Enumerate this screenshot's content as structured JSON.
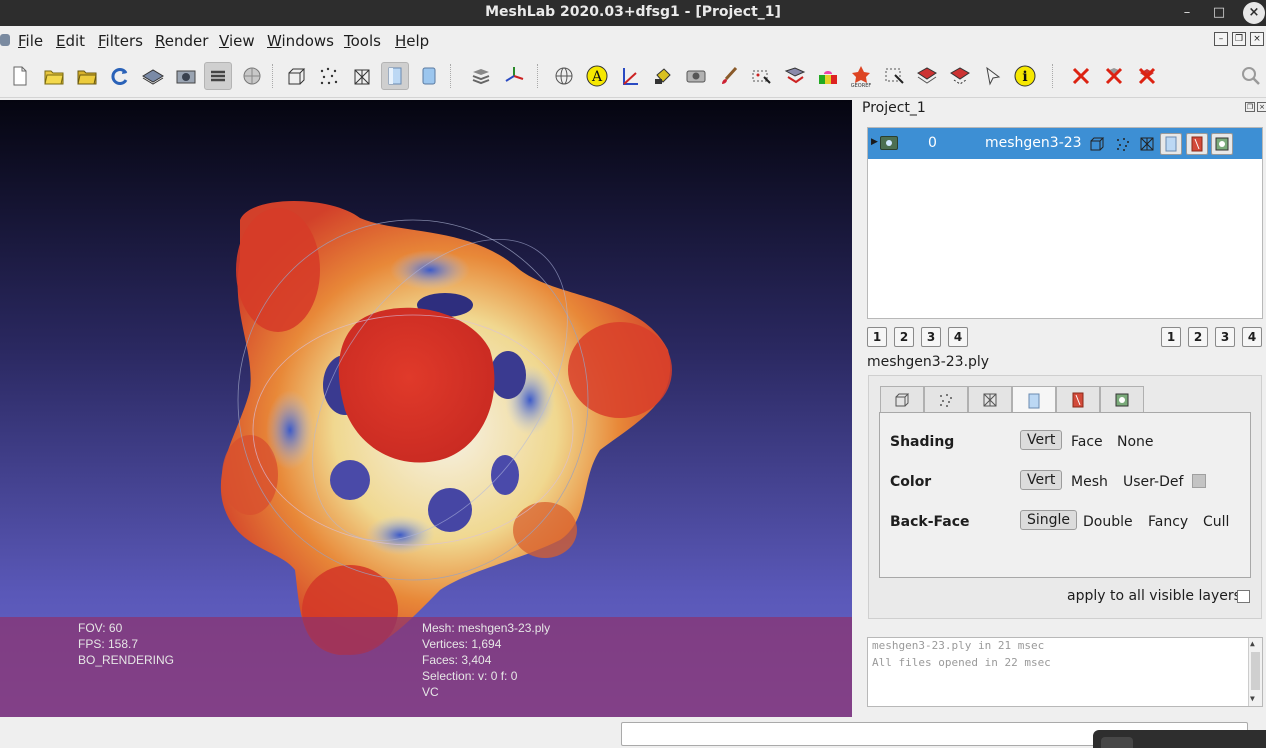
{
  "window": {
    "title": "MeshLab 2020.03+dfsg1 - [Project_1]"
  },
  "controls": {
    "minimize": "–",
    "maximize": "□",
    "close": "×"
  },
  "menu": [
    {
      "key": "F",
      "rest": "ile"
    },
    {
      "key": "E",
      "rest": "dit"
    },
    {
      "key": "F",
      "rest": "ilters"
    },
    {
      "key": "R",
      "rest": "ender"
    },
    {
      "key": "V",
      "rest": "iew"
    },
    {
      "key": "W",
      "rest": "indows"
    },
    {
      "key": "T",
      "rest": "ools"
    },
    {
      "key": "H",
      "rest": "elp"
    }
  ],
  "toolbar": {
    "icons": [
      "new-project-icon",
      "open-project-icon",
      "import-mesh-icon",
      "reload-icon",
      "export-mesh-icon",
      "snapshot-icon",
      "layers-icon",
      "light-icon",
      "bounding-box-icon",
      "points-icon",
      "wireframe-icon",
      "flat-icon",
      "smooth-icon",
      "layer-stack-icon",
      "axes-icon",
      "globe-icon",
      "annotation-icon",
      "measure-icon",
      "paint-bucket-icon",
      "camera-icon",
      "brush-icon",
      "select-vertices-icon",
      "select-faces-icon",
      "color-paint-icon",
      "georef-icon",
      "select-area-icon",
      "select-connected-icon",
      "select-component-icon",
      "select-pointer-icon",
      "info-icon",
      "delete-selected-vertices-icon",
      "delete-selected-faces-icon",
      "delete-selected-all-icon",
      "search-icon"
    ],
    "annotation_glyph": "A",
    "info_glyph": "i"
  },
  "viewport": {
    "left_info": [
      "FOV: 60",
      "FPS:   158.7",
      "BO_RENDERING"
    ],
    "mesh_info": [
      "Mesh: meshgen3-23.ply",
      "Vertices: 1,694",
      "Faces: 3,404",
      "Selection: v: 0 f: 0",
      "VC"
    ]
  },
  "panel": {
    "title": "Project_1",
    "layer": {
      "index": "0",
      "name": "meshgen3-23"
    },
    "left_buttons": [
      "1",
      "2",
      "3",
      "4"
    ],
    "right_buttons": [
      "1",
      "2",
      "3",
      "4"
    ],
    "mesh_file": "meshgen3-23.ply",
    "props": {
      "shading": {
        "label": "Shading",
        "options": [
          "Vert",
          "Face",
          "None"
        ],
        "selected": "Vert"
      },
      "color": {
        "label": "Color",
        "options": [
          "Vert",
          "Mesh",
          "User-Def"
        ],
        "selected": "Vert"
      },
      "backface": {
        "label": "Back-Face",
        "options": [
          "Single",
          "Double",
          "Fancy",
          "Cull"
        ],
        "selected": "Single"
      }
    },
    "apply_all": "apply to all visible layers"
  },
  "log": [
    "meshgen3-23.ply in 21 msec",
    "All files opened in 22 msec"
  ]
}
